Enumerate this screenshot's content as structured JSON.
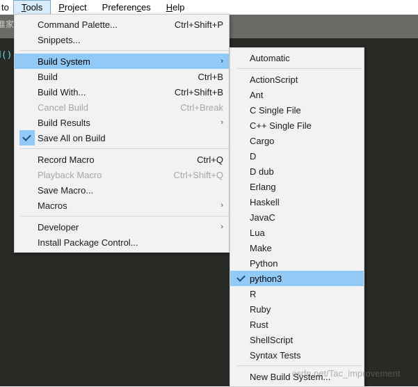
{
  "menubar": {
    "items": [
      {
        "label": "to",
        "mnemonic": "",
        "truncated": true,
        "active": false
      },
      {
        "label": "Tools",
        "mnemonic": "T",
        "truncated": false,
        "active": true
      },
      {
        "label": "Project",
        "mnemonic": "P",
        "truncated": false,
        "active": false
      },
      {
        "label": "Preferences",
        "mnemonic": "c",
        "truncated": false,
        "active": false
      },
      {
        "label": "Help",
        "mnemonic": "H",
        "truncated": false,
        "active": false
      }
    ]
  },
  "editor": {
    "sidebar_text": "准家工",
    "code_text": "d()"
  },
  "tools_menu": {
    "items": [
      {
        "type": "item",
        "label": "Command Palette...",
        "shortcut": "Ctrl+Shift+P",
        "state": "normal",
        "checked": false,
        "submenu": false
      },
      {
        "type": "item",
        "label": "Snippets...",
        "shortcut": "",
        "state": "normal",
        "checked": false,
        "submenu": false
      },
      {
        "type": "separator"
      },
      {
        "type": "item",
        "label": "Build System",
        "shortcut": "",
        "state": "highlighted",
        "checked": false,
        "submenu": true
      },
      {
        "type": "item",
        "label": "Build",
        "shortcut": "Ctrl+B",
        "state": "normal",
        "checked": false,
        "submenu": false
      },
      {
        "type": "item",
        "label": "Build With...",
        "shortcut": "Ctrl+Shift+B",
        "state": "normal",
        "checked": false,
        "submenu": false
      },
      {
        "type": "item",
        "label": "Cancel Build",
        "shortcut": "Ctrl+Break",
        "state": "disabled",
        "checked": false,
        "submenu": false
      },
      {
        "type": "item",
        "label": "Build Results",
        "shortcut": "",
        "state": "normal",
        "checked": false,
        "submenu": true
      },
      {
        "type": "item",
        "label": "Save All on Build",
        "shortcut": "",
        "state": "normal",
        "checked": true,
        "submenu": false
      },
      {
        "type": "separator"
      },
      {
        "type": "item",
        "label": "Record Macro",
        "shortcut": "Ctrl+Q",
        "state": "normal",
        "checked": false,
        "submenu": false
      },
      {
        "type": "item",
        "label": "Playback Macro",
        "shortcut": "Ctrl+Shift+Q",
        "state": "disabled",
        "checked": false,
        "submenu": false
      },
      {
        "type": "item",
        "label": "Save Macro...",
        "shortcut": "",
        "state": "normal",
        "checked": false,
        "submenu": false
      },
      {
        "type": "item",
        "label": "Macros",
        "shortcut": "",
        "state": "normal",
        "checked": false,
        "submenu": true
      },
      {
        "type": "separator"
      },
      {
        "type": "item",
        "label": "Developer",
        "shortcut": "",
        "state": "normal",
        "checked": false,
        "submenu": true
      },
      {
        "type": "item",
        "label": "Install Package Control...",
        "shortcut": "",
        "state": "normal",
        "checked": false,
        "submenu": false
      }
    ]
  },
  "build_system_submenu": {
    "items": [
      {
        "type": "item",
        "label": "Automatic",
        "state": "normal",
        "checked": false
      },
      {
        "type": "separator"
      },
      {
        "type": "item",
        "label": "ActionScript",
        "state": "normal",
        "checked": false
      },
      {
        "type": "item",
        "label": "Ant",
        "state": "normal",
        "checked": false
      },
      {
        "type": "item",
        "label": "C Single File",
        "state": "normal",
        "checked": false
      },
      {
        "type": "item",
        "label": "C++ Single File",
        "state": "normal",
        "checked": false
      },
      {
        "type": "item",
        "label": "Cargo",
        "state": "normal",
        "checked": false
      },
      {
        "type": "item",
        "label": "D",
        "state": "normal",
        "checked": false
      },
      {
        "type": "item",
        "label": "D dub",
        "state": "normal",
        "checked": false
      },
      {
        "type": "item",
        "label": "Erlang",
        "state": "normal",
        "checked": false
      },
      {
        "type": "item",
        "label": "Haskell",
        "state": "normal",
        "checked": false
      },
      {
        "type": "item",
        "label": "JavaC",
        "state": "normal",
        "checked": false
      },
      {
        "type": "item",
        "label": "Lua",
        "state": "normal",
        "checked": false
      },
      {
        "type": "item",
        "label": "Make",
        "state": "normal",
        "checked": false
      },
      {
        "type": "item",
        "label": "Python",
        "state": "normal",
        "checked": false
      },
      {
        "type": "item",
        "label": "python3",
        "state": "highlighted",
        "checked": true
      },
      {
        "type": "item",
        "label": "R",
        "state": "normal",
        "checked": false
      },
      {
        "type": "item",
        "label": "Ruby",
        "state": "normal",
        "checked": false
      },
      {
        "type": "item",
        "label": "Rust",
        "state": "normal",
        "checked": false
      },
      {
        "type": "item",
        "label": "ShellScript",
        "state": "normal",
        "checked": false
      },
      {
        "type": "item",
        "label": "Syntax Tests",
        "state": "normal",
        "checked": false
      },
      {
        "type": "separator"
      },
      {
        "type": "item",
        "label": "New Build System...",
        "state": "normal",
        "checked": false
      }
    ]
  },
  "watermark": {
    "text": "csdn.net/Tac_improvement"
  },
  "colors": {
    "menu_background": "#f2f2f2",
    "highlight": "#91c9f7",
    "menubar_active": "#d8ecfb",
    "editor_background": "#282a26",
    "toolbar_band": "#6b6b66",
    "disabled_text": "#a6a6a6"
  }
}
